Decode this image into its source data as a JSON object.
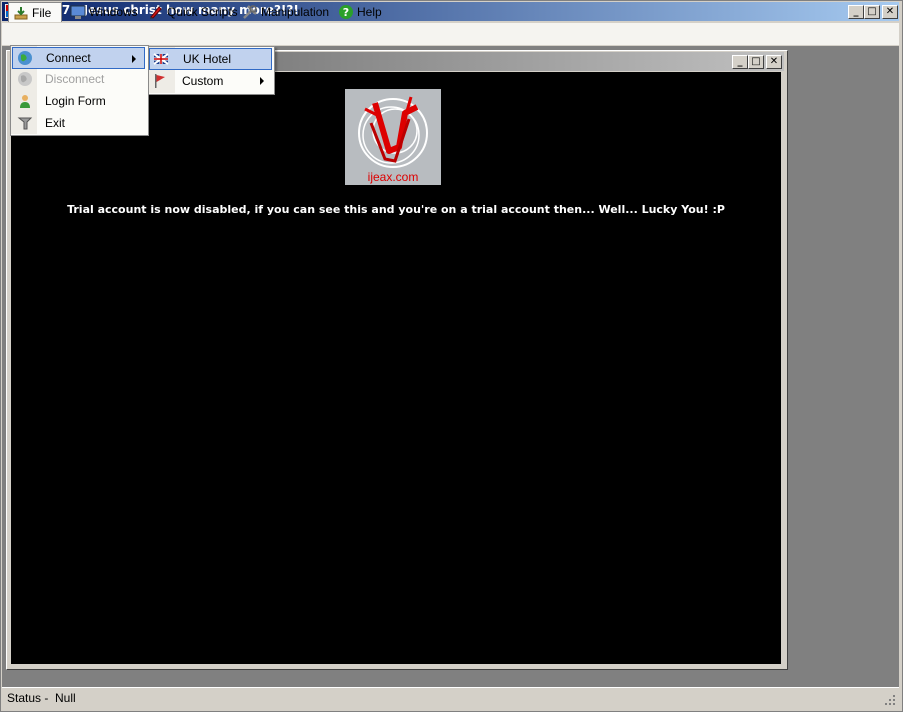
{
  "window": {
    "title": "Axed 7 - Jesus christ how many more?!?!",
    "controls": {
      "minimize": "_",
      "maximize": "□",
      "close": "✕"
    }
  },
  "menubar": {
    "items": [
      {
        "label": "File",
        "icon": "download-icon"
      },
      {
        "label": "Windows",
        "icon": "monitor-icon"
      },
      {
        "label": "Quick Scripts",
        "icon": "pencil-icon"
      },
      {
        "label": "Manipulation",
        "icon": "tools-icon"
      },
      {
        "label": "Help",
        "icon": "help-icon"
      }
    ]
  },
  "file_menu": {
    "items": [
      {
        "label": "Connect",
        "icon": "globe-icon",
        "highlighted": true,
        "has_submenu": true
      },
      {
        "label": "Disconnect",
        "icon": "globe-disabled-icon",
        "disabled": true
      },
      {
        "label": "Login Form",
        "icon": "user-icon"
      },
      {
        "label": "Exit",
        "icon": "exit-icon"
      }
    ]
  },
  "connect_submenu": {
    "items": [
      {
        "label": "UK Hotel",
        "icon": "uk-flag-icon",
        "highlighted": true
      },
      {
        "label": "Custom",
        "icon": "red-flag-icon",
        "has_submenu": true
      }
    ]
  },
  "child_window": {
    "controls": {
      "minimize": "_",
      "maximize": "□",
      "close": "✕"
    },
    "logo_text": "ijeax.com",
    "message": "Trial account is now disabled, if you can see this and you're on a trial account then... Well... Lucky You! :P"
  },
  "statusbar": {
    "text": "Status -  Null"
  },
  "colors": {
    "title_active": "#0a246a",
    "menu_highlight": "#c1d2ee",
    "menu_highlight_border": "#316ac5",
    "content_bg": "#000000",
    "logo_red": "#dd0000"
  }
}
